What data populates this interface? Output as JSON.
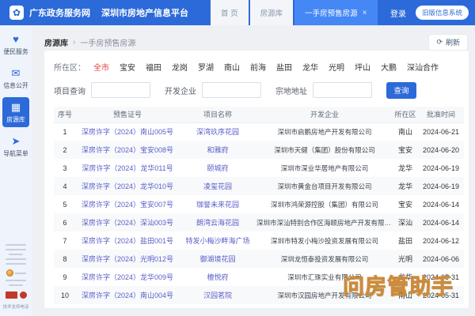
{
  "header": {
    "site_name": "广东政务服务网",
    "platform_title": "深圳市房地产信息平台",
    "logo_icon": "gov-flower-icon",
    "tabs": [
      {
        "label": "首 页",
        "active": false,
        "closable": false
      },
      {
        "label": "房源库",
        "active": false,
        "closable": false
      },
      {
        "label": "一手房预售房源",
        "active": true,
        "closable": true
      }
    ],
    "close_glyph": "×",
    "login_label": "登录",
    "legacy_button_label": "旧版信息系统"
  },
  "sidebar": {
    "items": [
      {
        "label": "便民服务",
        "icon": "service-heart-icon",
        "glyph": "♥",
        "active": false
      },
      {
        "label": "信息公开",
        "icon": "mail-icon",
        "glyph": "✉",
        "active": false
      },
      {
        "label": "房源库",
        "icon": "building-icon",
        "glyph": "▦",
        "active": true
      },
      {
        "label": "导航菜单",
        "icon": "paper-plane-icon",
        "glyph": "➤",
        "active": false
      }
    ],
    "support_text": "技术支持电话"
  },
  "breadcrumb": {
    "parent": "房源库",
    "separator": "›",
    "current": "一手房预售房源"
  },
  "refresh_label": "刷新",
  "refresh_icon": "⟳",
  "filters": {
    "label": "所在区：",
    "options": [
      "全市",
      "宝安",
      "福田",
      "龙岗",
      "罗湖",
      "南山",
      "前海",
      "盐田",
      "龙华",
      "光明",
      "坪山",
      "大鹏",
      "深汕合作"
    ],
    "active_option": "全市",
    "active_color": "#e23d3d"
  },
  "search": {
    "fields": [
      {
        "label": "项目查询",
        "value": "",
        "placeholder": ""
      },
      {
        "label": "开发企业",
        "value": "",
        "placeholder": ""
      },
      {
        "label": "宗地地址",
        "value": "",
        "placeholder": ""
      }
    ],
    "button_label": "查询"
  },
  "table": {
    "columns": [
      "序号",
      "预售证号",
      "项目名称",
      "开发企业",
      "所在区",
      "批准时间"
    ],
    "rows": [
      [
        "1",
        "深房许字（2024）南山005号",
        "深湾玖序花园",
        "深圳市启鹏房地产开发有限公司",
        "南山",
        "2024-06-21"
      ],
      [
        "2",
        "深房许字（2024）宝安008号",
        "和雅府",
        "深圳市天健（集团）股份有限公司",
        "宝安",
        "2024-06-20"
      ],
      [
        "3",
        "深房许字（2024）龙华011号",
        "颐城府",
        "深圳市深业华居地产有限公司",
        "龙华",
        "2024-06-19"
      ],
      [
        "4",
        "深房许字（2024）龙华010号",
        "凌玺花园",
        "深圳市黄金台项目开发有限公司",
        "龙华",
        "2024-06-19"
      ],
      [
        "5",
        "深房许字（2024）宝安007号",
        "珈誉未来花园",
        "深圳市鸿荣源控股（集团）有限公司",
        "宝安",
        "2024-06-14"
      ],
      [
        "6",
        "深房许字（2024）深汕003号",
        "朗湾云海花园",
        "深圳市深汕特别合作区海颐房地产开发有限公司",
        "深汕",
        "2024-06-14"
      ],
      [
        "7",
        "深房许字（2024）盐田001号",
        "特发小梅沙畔海广场",
        "深圳市特发小梅沙投资发展有限公司",
        "盐田",
        "2024-06-12"
      ],
      [
        "8",
        "深房许字（2024）光明012号",
        "御湖境花园",
        "深圳龙恒泰投资发展有限公司",
        "光明",
        "2024-06-06"
      ],
      [
        "9",
        "深房许字（2024）龙华009号",
        "檀悦府",
        "深圳市汇珠实业有限公司",
        "龙华",
        "2024-05-31"
      ],
      [
        "10",
        "深房许字（2024）南山004号",
        "汉园茗院",
        "深圳市汉园房地产开发有限公司",
        "南山",
        "2024-05-31"
      ]
    ]
  },
  "watermark": "问房管助手",
  "colors": {
    "header_bg": "#2c6ad9",
    "active_tab_bg": "#4587f5",
    "link_color": "#5a5ec8",
    "filter_active": "#e23d3d",
    "watermark_orange": "#e7a758"
  }
}
